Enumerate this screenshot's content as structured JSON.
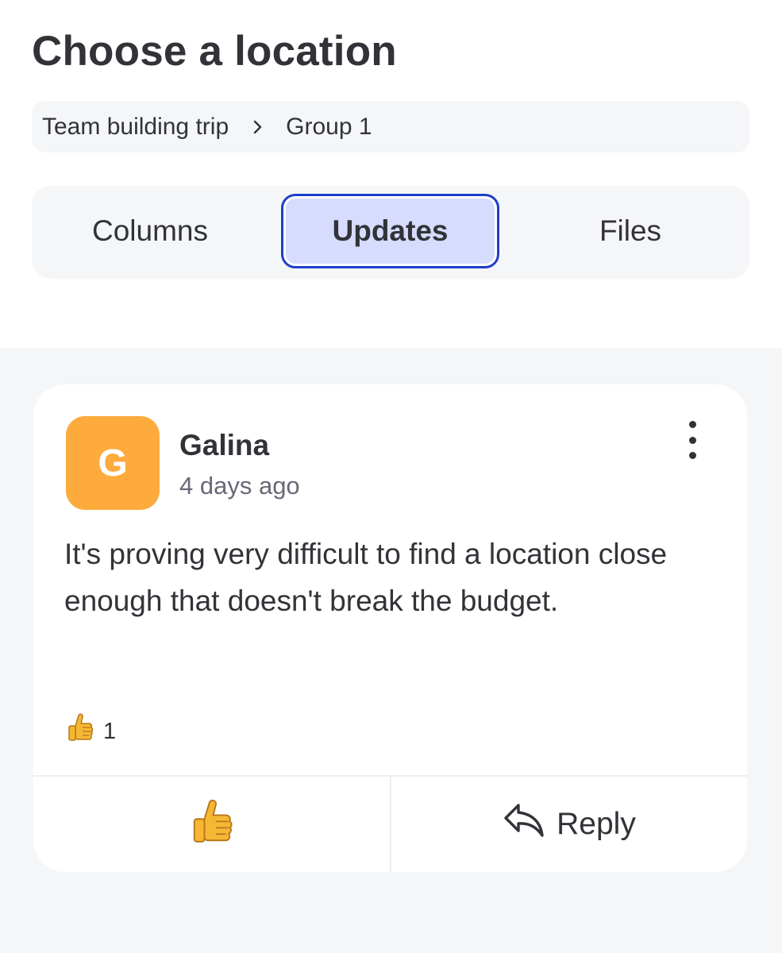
{
  "header": {
    "title": "Choose a location"
  },
  "breadcrumb": {
    "items": [
      "Team building trip",
      "Group 1"
    ]
  },
  "tabs": [
    {
      "label": "Columns",
      "active": false
    },
    {
      "label": "Updates",
      "active": true
    },
    {
      "label": "Files",
      "active": false
    }
  ],
  "update": {
    "avatar_initial": "G",
    "avatar_color": "#fdab3d",
    "author": "Galina",
    "time": "4 days ago",
    "text": "It's proving very difficult to find a location close enough that doesn't break the budget.",
    "reaction_icon": "thumbs-up-icon",
    "reaction_count": "1",
    "actions": {
      "like_icon": "thumbs-up-icon",
      "reply_icon": "reply-arrow-icon",
      "reply_label": "Reply"
    }
  },
  "colors": {
    "accent": "#1f3ecb",
    "active_tab_bg": "#d7dcfe",
    "surface": "#f5f6f8"
  }
}
